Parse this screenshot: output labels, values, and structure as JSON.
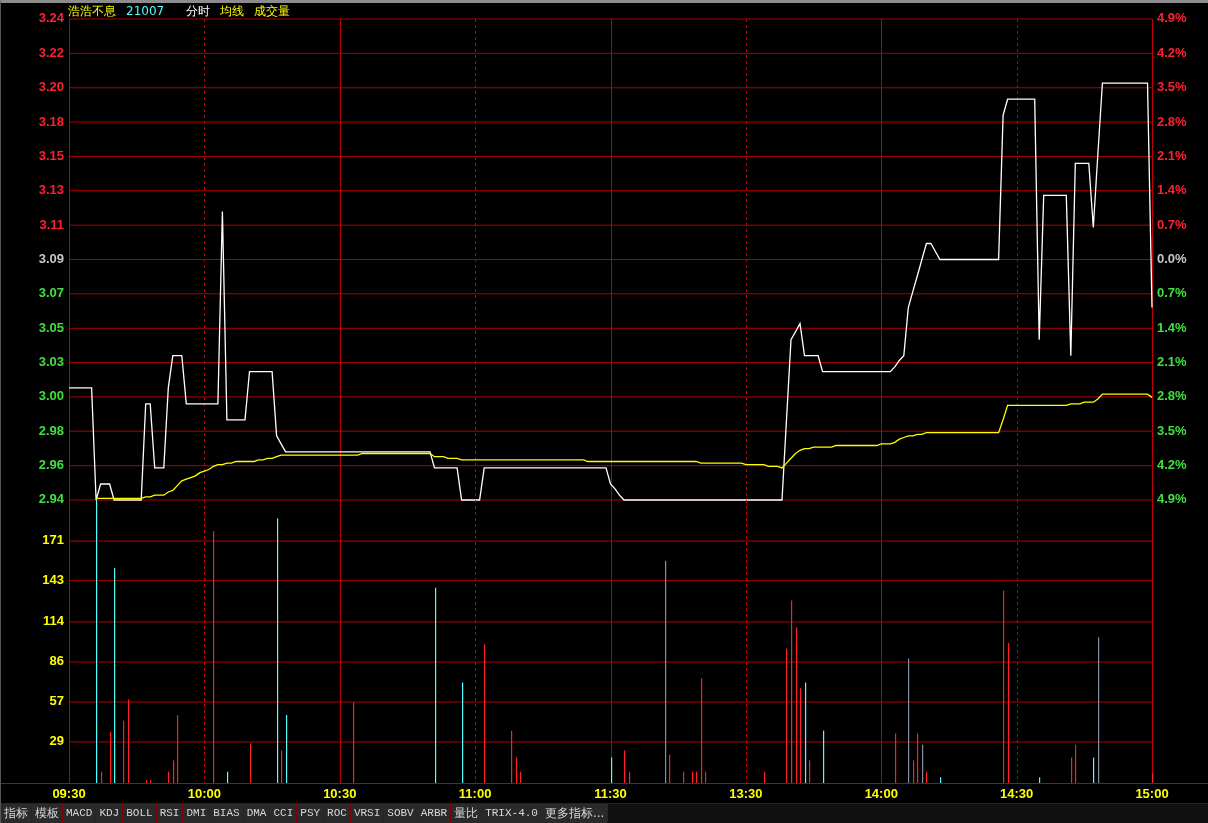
{
  "header": {
    "items": [
      {
        "label": "浩浩不息",
        "kind": "name"
      },
      {
        "label": "21007",
        "kind": "code"
      },
      {
        "label": "分时",
        "kind": "mode"
      },
      {
        "label": "均线",
        "kind": "overlay"
      },
      {
        "label": "成交量",
        "kind": "overlay"
      }
    ]
  },
  "price_chart": {
    "chart_data": {
      "type": "line",
      "categories": [
        null,
        null,
        null,
        null,
        null,
        null,
        null,
        null,
        null,
        null,
        null,
        null,
        null,
        null,
        null,
        null,
        null,
        null,
        null,
        null,
        null,
        null,
        null,
        null,
        null,
        null,
        null,
        null,
        null,
        null,
        null,
        null,
        null,
        null,
        null,
        null,
        null,
        null,
        null,
        null,
        null,
        null,
        null,
        null,
        null,
        null,
        null,
        null,
        null,
        null,
        null,
        null,
        null,
        null,
        null,
        null,
        null,
        null,
        null,
        null,
        null,
        null,
        null,
        null,
        null,
        null,
        null,
        null,
        null,
        null,
        null,
        null,
        null,
        null,
        null,
        null,
        null,
        null,
        null,
        null,
        null,
        null,
        null,
        null,
        null,
        null,
        null,
        null,
        null,
        null,
        null,
        null,
        null,
        null,
        null,
        null,
        null,
        null,
        null,
        null,
        null,
        null,
        null,
        null,
        null,
        null,
        null,
        null,
        null,
        null,
        null,
        null,
        null,
        null,
        null,
        null,
        null,
        null,
        null,
        null,
        null,
        null,
        null,
        null,
        null,
        null,
        null,
        null,
        null,
        null,
        null,
        null,
        null,
        null,
        null,
        null,
        null,
        null,
        null,
        null,
        null,
        null,
        null,
        null,
        null,
        null,
        null,
        null,
        null,
        null,
        null,
        null,
        null,
        null,
        null,
        null,
        null,
        null,
        null,
        null,
        null,
        null,
        null,
        null,
        null,
        null,
        null,
        null,
        null,
        null,
        null,
        null,
        null,
        null,
        null,
        null,
        null,
        null,
        null,
        null,
        null,
        null,
        null,
        null,
        null,
        null,
        null,
        null,
        null,
        null,
        null,
        null,
        null,
        null,
        null,
        null,
        null,
        null,
        null,
        null,
        null,
        null,
        null,
        null,
        null,
        null,
        null,
        null,
        null,
        null,
        null,
        null,
        null,
        null,
        null,
        null,
        null,
        null,
        null,
        null,
        null,
        null,
        null,
        null,
        null,
        null,
        null,
        null,
        null,
        null,
        null,
        null,
        null,
        null,
        null,
        null,
        null,
        null,
        null,
        null,
        null
      ],
      "series": [
        {
          "color": "#ffffff",
          "values": [
            3.01,
            3.01,
            3.01,
            3.01,
            3.01,
            3.01,
            2.94,
            2.95,
            2.95,
            2.95,
            2.94,
            2.94,
            2.94,
            2.94,
            2.94,
            2.94,
            2.94,
            3.0,
            3.0,
            2.96,
            2.96,
            2.96,
            3.01,
            3.03,
            3.03,
            3.03,
            3.0,
            3.0,
            3.0,
            3.0,
            3.0,
            3.0,
            3.0,
            3.0,
            3.12,
            2.99,
            2.99,
            2.99,
            2.99,
            2.99,
            3.02,
            3.02,
            3.02,
            3.02,
            3.02,
            3.02,
            2.98,
            2.975,
            2.97,
            2.97,
            2.97,
            2.97,
            2.97,
            2.97,
            2.97,
            2.97,
            2.97,
            2.97,
            2.97,
            2.97,
            2.97,
            2.97,
            2.97,
            2.97,
            2.97,
            2.97,
            2.97,
            2.97,
            2.97,
            2.97,
            2.97,
            2.97,
            2.97,
            2.97,
            2.97,
            2.97,
            2.97,
            2.97,
            2.97,
            2.97,
            2.97,
            2.96,
            2.96,
            2.96,
            2.96,
            2.96,
            2.96,
            2.94,
            2.94,
            2.94,
            2.94,
            2.94,
            2.96,
            2.96,
            2.96,
            2.96,
            2.96,
            2.96,
            2.96,
            2.96,
            2.96,
            2.96,
            2.96,
            2.96,
            2.96,
            2.96,
            2.96,
            2.96,
            2.96,
            2.96,
            2.96,
            2.96,
            2.96,
            2.96,
            2.96,
            2.96,
            2.96,
            2.96,
            2.96,
            2.96,
            2.95,
            2.947,
            2.943,
            2.94,
            2.94,
            2.94,
            2.94,
            2.94,
            2.94,
            2.94,
            2.94,
            2.94,
            2.94,
            2.94,
            2.94,
            2.94,
            2.94,
            2.94,
            2.94,
            2.94,
            2.94,
            2.94,
            2.94,
            2.94,
            2.94,
            2.94,
            2.94,
            2.94,
            2.94,
            2.94,
            2.94,
            2.94,
            2.94,
            2.94,
            2.94,
            2.94,
            2.94,
            2.94,
            2.94,
            2.99,
            3.04,
            3.045,
            3.05,
            3.03,
            3.03,
            3.03,
            3.03,
            3.02,
            3.02,
            3.02,
            3.02,
            3.02,
            3.02,
            3.02,
            3.02,
            3.02,
            3.02,
            3.02,
            3.02,
            3.02,
            3.02,
            3.02,
            3.02,
            3.023,
            3.027,
            3.03,
            3.06,
            3.07,
            3.08,
            3.09,
            3.1,
            3.1,
            3.095,
            3.09,
            3.09,
            3.09,
            3.09,
            3.09,
            3.09,
            3.09,
            3.09,
            3.09,
            3.09,
            3.09,
            3.09,
            3.09,
            3.09,
            3.18,
            3.19,
            3.19,
            3.19,
            3.19,
            3.19,
            3.19,
            3.19,
            3.04,
            3.13,
            3.13,
            3.13,
            3.13,
            3.13,
            3.13,
            3.03,
            3.15,
            3.15,
            3.15,
            3.15,
            3.11,
            3.155,
            3.2,
            3.2,
            3.2,
            3.2,
            3.2,
            3.2,
            3.2,
            3.2,
            3.2,
            3.2,
            3.2,
            3.06
          ]
        },
        {
          "color": "#ffff00",
          "values": [
            null,
            null,
            null,
            null,
            null,
            null,
            2.941,
            2.941,
            2.941,
            2.941,
            2.941,
            2.941,
            2.941,
            2.941,
            2.941,
            2.941,
            2.941,
            2.942,
            2.942,
            2.943,
            2.943,
            2.943,
            2.945,
            2.946,
            2.949,
            2.952,
            2.953,
            2.954,
            2.955,
            2.957,
            2.958,
            2.959,
            2.961,
            2.962,
            2.962,
            2.963,
            2.963,
            2.964,
            2.964,
            2.964,
            2.964,
            2.964,
            2.965,
            2.965,
            2.966,
            2.966,
            2.967,
            2.968,
            2.968,
            2.968,
            2.968,
            2.968,
            2.968,
            2.968,
            2.968,
            2.968,
            2.968,
            2.968,
            2.968,
            2.968,
            2.968,
            2.968,
            2.968,
            2.968,
            2.968,
            2.969,
            2.969,
            2.969,
            2.969,
            2.969,
            2.969,
            2.969,
            2.969,
            2.969,
            2.969,
            2.969,
            2.969,
            2.969,
            2.969,
            2.969,
            2.969,
            2.967,
            2.967,
            2.967,
            2.966,
            2.966,
            2.966,
            2.965,
            2.965,
            2.965,
            2.965,
            2.965,
            2.965,
            2.965,
            2.965,
            2.965,
            2.965,
            2.965,
            2.965,
            2.965,
            2.965,
            2.965,
            2.965,
            2.965,
            2.965,
            2.965,
            2.965,
            2.965,
            2.965,
            2.965,
            2.965,
            2.965,
            2.965,
            2.965,
            2.965,
            2.964,
            2.964,
            2.964,
            2.964,
            2.964,
            2.964,
            2.964,
            2.964,
            2.964,
            2.964,
            2.964,
            2.964,
            2.964,
            2.964,
            2.964,
            2.964,
            2.964,
            2.964,
            2.964,
            2.964,
            2.964,
            2.964,
            2.964,
            2.964,
            2.964,
            2.963,
            2.963,
            2.963,
            2.963,
            2.963,
            2.963,
            2.963,
            2.963,
            2.963,
            2.963,
            2.962,
            2.962,
            2.962,
            2.962,
            2.962,
            2.961,
            2.961,
            2.961,
            2.96,
            2.963,
            2.966,
            2.969,
            2.971,
            2.972,
            2.972,
            2.973,
            2.973,
            2.973,
            2.973,
            2.973,
            2.974,
            2.974,
            2.974,
            2.974,
            2.974,
            2.974,
            2.974,
            2.974,
            2.974,
            2.974,
            2.975,
            2.975,
            2.975,
            2.976,
            2.978,
            2.979,
            2.98,
            2.98,
            2.981,
            2.981,
            2.982,
            2.982,
            2.982,
            2.982,
            2.982,
            2.982,
            2.982,
            2.982,
            2.982,
            2.982,
            2.982,
            2.982,
            2.982,
            2.982,
            2.982,
            2.982,
            2.982,
            2.99,
            2.999,
            2.999,
            2.999,
            2.999,
            2.999,
            2.999,
            2.999,
            2.999,
            2.999,
            2.999,
            2.999,
            2.999,
            2.999,
            2.999,
            3.0,
            3.0,
            3.0,
            3.001,
            3.001,
            3.001,
            3.003,
            3.006,
            3.006,
            3.006,
            3.006,
            3.006,
            3.006,
            3.006,
            3.006,
            3.006,
            3.006,
            3.006,
            3.004
          ]
        }
      ],
      "ylim": [
        2.94,
        3.24
      ],
      "grid": true,
      "yticks": [
        {
          "value": 2.94,
          "label": "2.94"
        },
        {
          "value": 2.9614,
          "label": "2.96"
        },
        {
          "value": 2.9829,
          "label": "2.98"
        },
        {
          "value": 3.0043,
          "label": "3.00"
        },
        {
          "value": 3.0257,
          "label": "3.03"
        },
        {
          "value": 3.0471,
          "label": "3.05"
        },
        {
          "value": 3.0686,
          "label": "3.07"
        },
        {
          "value": 3.09,
          "label": "3.09"
        },
        {
          "value": 3.1114,
          "label": "3.11"
        },
        {
          "value": 3.1329,
          "label": "3.13"
        },
        {
          "value": 3.1543,
          "label": "3.15"
        },
        {
          "value": 3.1757,
          "label": "3.18"
        },
        {
          "value": 3.1971,
          "label": "3.20"
        },
        {
          "value": 3.2186,
          "label": "3.22"
        },
        {
          "value": 3.24,
          "label": "3.24"
        }
      ]
    },
    "percent_axis": [
      {
        "label": "4.9%",
        "color": "#ff2030"
      },
      {
        "label": "4.2%",
        "color": "#ff2030"
      },
      {
        "label": "3.5%",
        "color": "#ff2030"
      },
      {
        "label": "2.8%",
        "color": "#ff2030"
      },
      {
        "label": "2.1%",
        "color": "#ff2030"
      },
      {
        "label": "1.4%",
        "color": "#ff2030"
      },
      {
        "label": "0.7%",
        "color": "#ff2030"
      },
      {
        "label": "0.0%",
        "color": "#c8c8c8"
      },
      {
        "label": "0.7%",
        "color": "#40e040"
      },
      {
        "label": "1.4%",
        "color": "#40e040"
      },
      {
        "label": "2.1%",
        "color": "#40e040"
      },
      {
        "label": "2.8%",
        "color": "#40e040"
      },
      {
        "label": "3.5%",
        "color": "#40e040"
      },
      {
        "label": "4.2%",
        "color": "#40e040"
      },
      {
        "label": "4.9%",
        "color": "#40e040"
      }
    ]
  },
  "volume_chart": {
    "chart_data": {
      "type": "bar",
      "categories": [
        "09:30",
        null,
        null,
        null,
        null,
        null,
        null,
        null,
        null,
        null,
        null,
        null,
        null,
        null,
        null,
        null,
        null,
        null,
        null,
        null,
        null,
        null,
        null,
        null,
        null,
        null,
        null,
        null,
        null,
        null,
        "10:00",
        null,
        null,
        null,
        null,
        null,
        null,
        null,
        null,
        null,
        null,
        null,
        null,
        null,
        null,
        null,
        null,
        null,
        null,
        null,
        null,
        null,
        null,
        null,
        null,
        null,
        null,
        null,
        null,
        null,
        "10:30",
        null,
        null,
        null,
        null,
        null,
        null,
        null,
        null,
        null,
        null,
        null,
        null,
        null,
        null,
        null,
        null,
        null,
        null,
        null,
        null,
        null,
        null,
        null,
        null,
        null,
        null,
        null,
        null,
        null,
        "11:00",
        null,
        null,
        null,
        null,
        null,
        null,
        null,
        null,
        null,
        null,
        null,
        null,
        null,
        null,
        null,
        null,
        null,
        null,
        null,
        null,
        null,
        null,
        null,
        null,
        null,
        null,
        null,
        null,
        null,
        "11:30",
        null,
        null,
        null,
        null,
        null,
        null,
        null,
        null,
        null,
        null,
        null,
        null,
        null,
        null,
        null,
        null,
        null,
        null,
        null,
        null,
        null,
        null,
        null,
        null,
        null,
        null,
        null,
        null,
        null,
        "13:30",
        null,
        null,
        null,
        null,
        null,
        null,
        null,
        null,
        null,
        null,
        null,
        null,
        null,
        null,
        null,
        null,
        null,
        null,
        null,
        null,
        null,
        null,
        null,
        null,
        null,
        null,
        null,
        null,
        null,
        "14:00",
        null,
        null,
        null,
        null,
        null,
        null,
        null,
        null,
        null,
        null,
        null,
        null,
        null,
        null,
        null,
        null,
        null,
        null,
        null,
        null,
        null,
        null,
        null,
        null,
        null,
        null,
        null,
        null,
        null,
        "14:30",
        null,
        null,
        null,
        null,
        null,
        null,
        null,
        null,
        null,
        null,
        null,
        null,
        null,
        null,
        null,
        null,
        null,
        null,
        null,
        null,
        null,
        null,
        null,
        null,
        null,
        null,
        null,
        null,
        null,
        "15:00"
      ],
      "series": [
        {
          "color": "#ff2020",
          "values": [
            null,
            null,
            null,
            null,
            null,
            null,
            null,
            8,
            null,
            36,
            null,
            null,
            44,
            59,
            null,
            null,
            null,
            2,
            2,
            null,
            null,
            null,
            8,
            16,
            48,
            null,
            null,
            null,
            null,
            null,
            null,
            null,
            178,
            null,
            null,
            null,
            null,
            null,
            null,
            null,
            28,
            null,
            null,
            null,
            null,
            null,
            null,
            23,
            null,
            null,
            null,
            null,
            null,
            null,
            null,
            null,
            null,
            null,
            null,
            null,
            null,
            null,
            null,
            57,
            null,
            null,
            null,
            null,
            null,
            null,
            null,
            null,
            null,
            null,
            null,
            null,
            null,
            null,
            null,
            null,
            null,
            null,
            null,
            null,
            null,
            null,
            null,
            null,
            null,
            null,
            null,
            null,
            98,
            null,
            null,
            null,
            null,
            null,
            37,
            18,
            8,
            null,
            null,
            null,
            null,
            null,
            null,
            null,
            null,
            null,
            null,
            null,
            null,
            null,
            null,
            null,
            null,
            null,
            null,
            null,
            null,
            null,
            null,
            23,
            8,
            null,
            null,
            null,
            null,
            null,
            null,
            null,
            null,
            20,
            null,
            null,
            8,
            null,
            8,
            8,
            74,
            8,
            null,
            null,
            null,
            null,
            null,
            null,
            null,
            null,
            null,
            null,
            null,
            null,
            8,
            null,
            null,
            null,
            null,
            95,
            129,
            110,
            67,
            null,
            16,
            null,
            null,
            null,
            null,
            null,
            null,
            null,
            null,
            null,
            null,
            null,
            null,
            null,
            null,
            null,
            null,
            null,
            null,
            35,
            null,
            null,
            null,
            16,
            35,
            null,
            8,
            null,
            null,
            null,
            null,
            null,
            null,
            null,
            null,
            null,
            null,
            null,
            null,
            null,
            null,
            null,
            null,
            136,
            99,
            null,
            null,
            null,
            null,
            null,
            null,
            null,
            null,
            null,
            null,
            null,
            null,
            null,
            18,
            27,
            null,
            null,
            null,
            null,
            null,
            null,
            null,
            null,
            null,
            null,
            null,
            null,
            null,
            null,
            null,
            null,
            7
          ]
        },
        {
          "color": "#54fcfc",
          "values": [
            null,
            null,
            null,
            null,
            null,
            null,
            200,
            null,
            null,
            null,
            152,
            null,
            null,
            null,
            null,
            null,
            null,
            null,
            null,
            null,
            null,
            null,
            null,
            null,
            null,
            null,
            null,
            null,
            null,
            null,
            null,
            null,
            null,
            null,
            null,
            8,
            null,
            null,
            null,
            null,
            null,
            null,
            null,
            null,
            null,
            null,
            187,
            null,
            48,
            null,
            null,
            null,
            null,
            null,
            null,
            null,
            null,
            null,
            null,
            null,
            null,
            null,
            null,
            null,
            null,
            null,
            null,
            null,
            null,
            null,
            null,
            null,
            null,
            null,
            null,
            null,
            null,
            null,
            null,
            null,
            null,
            138,
            null,
            null,
            null,
            null,
            null,
            71,
            null,
            null,
            null,
            null,
            null,
            null,
            null,
            null,
            null,
            null,
            null,
            null,
            null,
            null,
            null,
            null,
            null,
            null,
            null,
            null,
            null,
            null,
            null,
            null,
            null,
            null,
            null,
            null,
            null,
            null,
            null,
            null,
            18,
            null,
            null,
            null,
            null,
            null,
            null,
            null,
            null,
            null,
            null,
            null,
            null,
            null,
            null,
            null,
            null,
            null,
            null,
            null,
            null,
            null,
            null,
            null,
            null,
            null,
            null,
            null,
            null,
            null,
            null,
            null,
            null,
            null,
            null,
            null,
            null,
            null,
            null,
            null,
            null,
            null,
            null,
            71,
            null,
            null,
            null,
            37,
            null,
            null,
            null,
            null,
            null,
            null,
            null,
            null,
            null,
            null,
            null,
            null,
            null,
            null,
            null,
            null,
            null,
            null,
            null,
            null,
            null,
            null,
            null,
            null,
            null,
            4,
            null,
            null,
            null,
            null,
            null,
            null,
            null,
            null,
            null,
            null,
            null,
            null,
            null,
            null,
            null,
            null,
            null,
            null,
            null,
            null,
            null,
            4,
            null,
            null,
            null,
            null,
            null,
            null,
            null,
            null,
            null,
            null,
            null,
            18,
            null,
            null,
            null,
            null,
            null,
            null,
            null,
            null,
            null,
            null,
            null,
            null,
            null
          ]
        },
        {
          "color": "#8090a0",
          "values": [
            null,
            null,
            null,
            null,
            null,
            null,
            null,
            null,
            null,
            null,
            null,
            null,
            null,
            null,
            null,
            null,
            null,
            null,
            null,
            null,
            null,
            null,
            null,
            null,
            null,
            null,
            null,
            null,
            null,
            null,
            null,
            null,
            null,
            null,
            null,
            null,
            null,
            null,
            null,
            null,
            null,
            null,
            null,
            null,
            null,
            null,
            null,
            null,
            null,
            null,
            null,
            null,
            null,
            null,
            null,
            null,
            null,
            null,
            null,
            null,
            null,
            null,
            null,
            null,
            null,
            null,
            null,
            null,
            null,
            null,
            null,
            null,
            null,
            null,
            null,
            null,
            null,
            null,
            null,
            null,
            null,
            null,
            null,
            null,
            null,
            null,
            null,
            null,
            null,
            null,
            null,
            null,
            null,
            null,
            null,
            null,
            null,
            null,
            null,
            null,
            null,
            null,
            null,
            null,
            null,
            null,
            null,
            null,
            null,
            null,
            null,
            null,
            null,
            null,
            null,
            null,
            null,
            null,
            null,
            null,
            null,
            null,
            null,
            null,
            null,
            null,
            null,
            null,
            null,
            null,
            null,
            null,
            157,
            null,
            null,
            null,
            null,
            null,
            null,
            null,
            null,
            null,
            null,
            null,
            null,
            null,
            null,
            null,
            null,
            null,
            null,
            null,
            null,
            null,
            null,
            null,
            null,
            null,
            null,
            null,
            null,
            null,
            null,
            null,
            null,
            null,
            null,
            null,
            null,
            null,
            null,
            null,
            null,
            null,
            null,
            null,
            null,
            null,
            null,
            null,
            null,
            null,
            null,
            null,
            null,
            null,
            88,
            null,
            null,
            27,
            null,
            null,
            null,
            null,
            null,
            null,
            null,
            null,
            null,
            null,
            null,
            null,
            null,
            null,
            null,
            null,
            null,
            null,
            null,
            null,
            null,
            null,
            null,
            null,
            null,
            null,
            null,
            null,
            null,
            null,
            null,
            null,
            null,
            null,
            null,
            null,
            null,
            null,
            103,
            null,
            null,
            null,
            null,
            null,
            null,
            null,
            null,
            null,
            null,
            null,
            null
          ]
        }
      ],
      "ylim": [
        0,
        200
      ],
      "grid": true,
      "yticks": [
        {
          "value": 29,
          "label": "29"
        },
        {
          "value": 57.2,
          "label": "57"
        },
        {
          "value": 85.5,
          "label": "86"
        },
        {
          "value": 113.8,
          "label": "114"
        },
        {
          "value": 143,
          "label": "143"
        },
        {
          "value": 171,
          "label": "171"
        }
      ]
    }
  },
  "indicator_tabs": [
    {
      "label": "指标",
      "selected": false
    },
    {
      "label": "模板",
      "selected": false
    },
    {
      "label": "MACD",
      "selected": false
    },
    {
      "label": "KDJ",
      "selected": false
    },
    {
      "label": "BOLL",
      "selected": false
    },
    {
      "label": "RSI",
      "selected": false
    },
    {
      "label": "DMI",
      "selected": false
    },
    {
      "label": "BIAS",
      "selected": false
    },
    {
      "label": "DMA",
      "selected": false
    },
    {
      "label": "CCI",
      "selected": false
    },
    {
      "label": "PSY",
      "selected": false
    },
    {
      "label": "ROC",
      "selected": false
    },
    {
      "label": "VRSI",
      "selected": false
    },
    {
      "label": "SOBV",
      "selected": false
    },
    {
      "label": "ARBR",
      "selected": false
    },
    {
      "label": "量比",
      "selected": false
    },
    {
      "label": "TRIX-4.0",
      "selected": false
    },
    {
      "label": "更多指标...",
      "selected": false
    }
  ]
}
